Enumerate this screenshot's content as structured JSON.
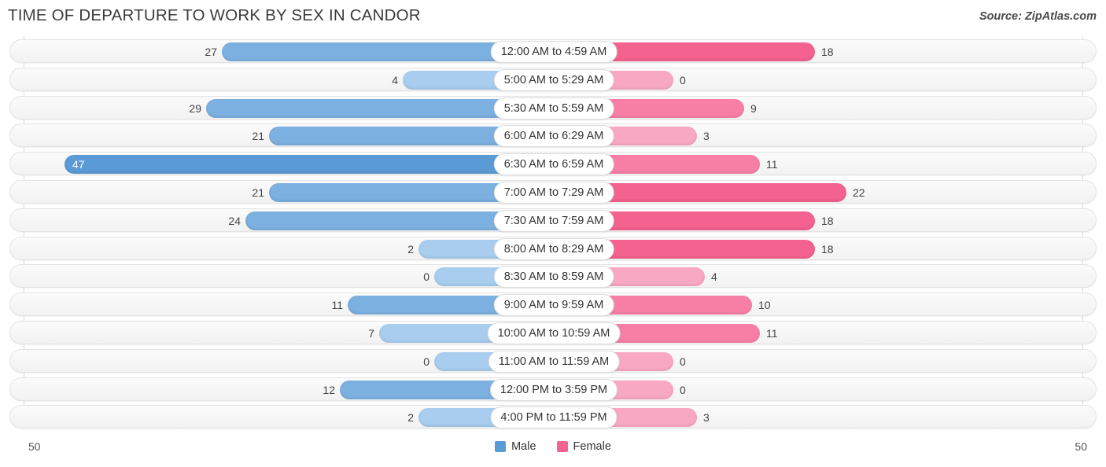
{
  "header": {
    "title": "TIME OF DEPARTURE TO WORK BY SEX IN CANDOR",
    "source": "Source: ZipAtlas.com"
  },
  "axis": {
    "left_label": "50",
    "right_label": "50"
  },
  "legend": {
    "items": [
      {
        "label": "Male",
        "color": "#5b9bd5"
      },
      {
        "label": "Female",
        "color": "#f4628f"
      }
    ]
  },
  "colors": {
    "male_strong": "#5b9bd5",
    "male_mid": "#7cb0e0",
    "male_light": "#a8cdee",
    "female_strong": "#f4628f",
    "female_mid": "#f77fa6",
    "female_light": "#f9a8c4",
    "row_background": "#f6f6f6",
    "row_border": "#e3e3e3",
    "gridline": "#d8d8d8",
    "title": "#3c3c3c"
  },
  "chart_data": {
    "type": "bar",
    "title": "TIME OF DEPARTURE TO WORK BY SEX IN CANDOR",
    "subtitle": "",
    "orientation": "horizontal-diverging",
    "xlabel": "",
    "ylabel": "",
    "xlim": [
      50,
      50
    ],
    "grid": true,
    "legend_position": "bottom-center",
    "categories": [
      "12:00 AM to 4:59 AM",
      "5:00 AM to 5:29 AM",
      "5:30 AM to 5:59 AM",
      "6:00 AM to 6:29 AM",
      "6:30 AM to 6:59 AM",
      "7:00 AM to 7:29 AM",
      "7:30 AM to 7:59 AM",
      "8:00 AM to 8:29 AM",
      "8:30 AM to 8:59 AM",
      "9:00 AM to 9:59 AM",
      "10:00 AM to 10:59 AM",
      "11:00 AM to 11:59 AM",
      "12:00 PM to 3:59 PM",
      "4:00 PM to 11:59 PM"
    ],
    "series": [
      {
        "name": "Male",
        "color": "#5b9bd5",
        "values": [
          27,
          4,
          29,
          21,
          47,
          21,
          24,
          2,
          0,
          11,
          7,
          0,
          12,
          2
        ]
      },
      {
        "name": "Female",
        "color": "#f4628f",
        "values": [
          18,
          0,
          9,
          3,
          11,
          22,
          18,
          18,
          4,
          10,
          11,
          0,
          0,
          3
        ]
      }
    ]
  }
}
